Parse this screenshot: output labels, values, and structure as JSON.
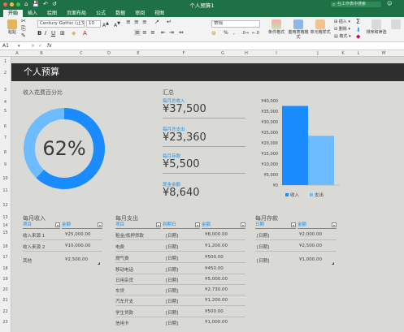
{
  "window": {
    "title": "个人预算1",
    "search_placeholder": "在工作表中搜索",
    "share_icon": "share-icon"
  },
  "quick_access": [
    "⌂",
    "💾",
    "↶",
    "↺"
  ],
  "ribbon_tabs": [
    "开始",
    "插入",
    "绘图",
    "页面布局",
    "公式",
    "数据",
    "审阅",
    "视图"
  ],
  "ribbon": {
    "paste_label": "粘贴",
    "font_name": "Century Gothic (正文)",
    "font_size": "10",
    "number_format": "常规",
    "cond_format": "条件格式",
    "table_format": "套用表格格式",
    "cell_style": "单元格样式",
    "insert": "插入",
    "delete": "删除",
    "format": "格式",
    "sort_filter": "排序和筛选",
    "chevron": "▾",
    "pct_btn": "%",
    "comma_btn": ",",
    "sum_btn": "Σ"
  },
  "formula_bar": {
    "cell_ref": "A1",
    "fx": "fx"
  },
  "columns": [
    "A",
    "B",
    "C",
    "D",
    "E",
    "F",
    "G",
    "H",
    "I",
    "J",
    "K",
    "L",
    "M"
  ],
  "rows": [
    "1",
    "2",
    "3",
    "4",
    "5",
    "6",
    "7",
    "8",
    "9",
    "10",
    "11",
    "12",
    "13",
    "14",
    "15",
    "16",
    "17",
    "18",
    "19",
    "20",
    "21",
    "22",
    "23",
    "24",
    "25",
    "26",
    "27",
    "28"
  ],
  "banner_title": "个人预算",
  "pct_section": {
    "title": "收入花费百分比",
    "value": "62%",
    "fraction": 0.62,
    "ring_color": "#1a8cff",
    "rest_color": "#6cbcff"
  },
  "summary": {
    "title": "汇总",
    "items": [
      {
        "label": "每月总收入",
        "value": "¥37,500"
      },
      {
        "label": "每月总支出",
        "value": "¥23,360"
      },
      {
        "label": "每月存款",
        "value": "¥5,500"
      },
      {
        "label": "现金余额",
        "value": "¥8,640"
      }
    ]
  },
  "chart_data": {
    "type": "bar",
    "categories": [
      ""
    ],
    "series": [
      {
        "name": "收入",
        "values": [
          37500
        ],
        "color": "#1a8cff"
      },
      {
        "name": "支出",
        "values": [
          23360
        ],
        "color": "#6cbcff"
      }
    ],
    "ylim": [
      0,
      40000
    ],
    "yticks": [
      "¥40,000",
      "¥35,000",
      "¥30,000",
      "¥25,000",
      "¥20,000",
      "¥15,000",
      "¥10,000",
      "¥5,000",
      "¥0"
    ],
    "legend": "bottom"
  },
  "income": {
    "title": "每月收入",
    "headers": [
      "项目",
      "金额"
    ],
    "rows": [
      [
        "收入来源 1",
        "¥25,000.00"
      ],
      [
        "收入来源 2",
        "¥10,000.00"
      ],
      [
        "其他",
        "¥2,500.00"
      ]
    ]
  },
  "expenses": {
    "title": "每月支出",
    "headers": [
      "项目",
      "到期日",
      "金额"
    ],
    "rows": [
      [
        "租金/抵押贷款",
        "[日期]",
        "¥8,000.00"
      ],
      [
        "电费",
        "[日期]",
        "¥1,200.00"
      ],
      [
        "燃气费",
        "[日期]",
        "¥500.00"
      ],
      [
        "移动电话",
        "[日期]",
        "¥450.00"
      ],
      [
        "日用杂货",
        "[日期]",
        "¥5,000.00"
      ],
      [
        "车贷",
        "[日期]",
        "¥2,730.00"
      ],
      [
        "汽车开支",
        "[日期]",
        "¥1,200.00"
      ],
      [
        "学生贷款",
        "[日期]",
        "¥500.00"
      ],
      [
        "信用卡",
        "[日期]",
        "¥1,000.00"
      ]
    ]
  },
  "savings": {
    "title": "每月存款",
    "headers": [
      "日期",
      "金额"
    ],
    "rows": [
      [
        "[日期]",
        "¥2,000.00"
      ],
      [
        "[日期]",
        "¥2,500.00"
      ],
      [
        "[日期]",
        "¥1,000.00"
      ]
    ]
  }
}
